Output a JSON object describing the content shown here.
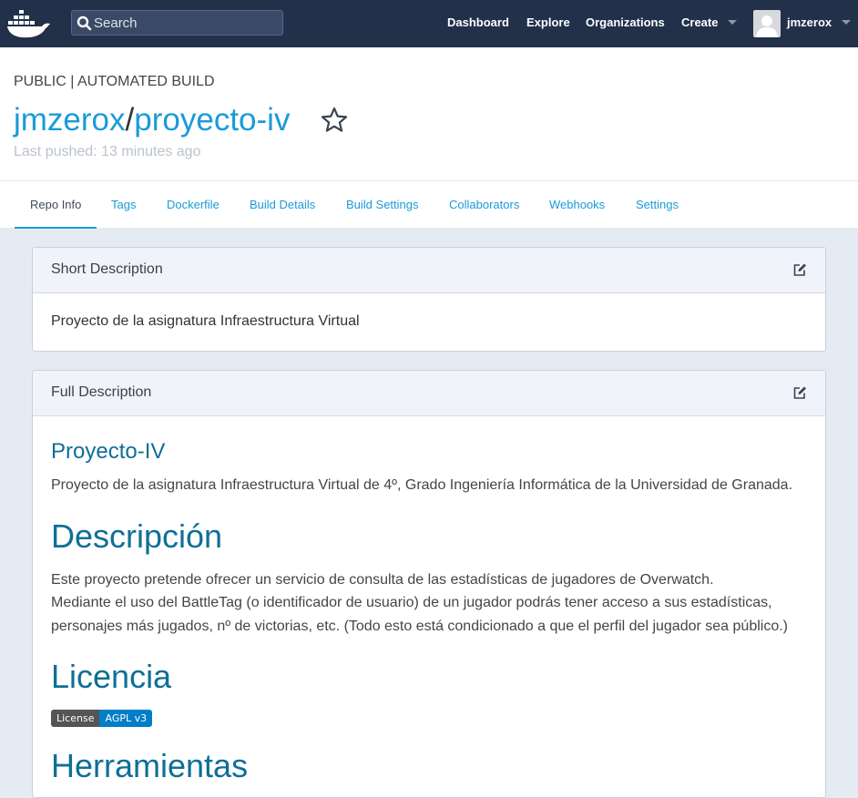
{
  "nav": {
    "search_placeholder": "Search",
    "links": [
      "Dashboard",
      "Explore",
      "Organizations",
      "Create"
    ],
    "username": "jmzerox"
  },
  "header": {
    "repo_type": "PUBLIC | AUTOMATED BUILD",
    "owner": "jmzerox",
    "separator": "/",
    "repo_name": "proyecto-iv",
    "last_pushed": "Last pushed: 13 minutes ago"
  },
  "tabs": [
    "Repo Info",
    "Tags",
    "Dockerfile",
    "Build Details",
    "Build Settings",
    "Collaborators",
    "Webhooks",
    "Settings"
  ],
  "short_description": {
    "title": "Short Description",
    "text": "Proyecto de la asignatura Infraestructura Virtual"
  },
  "full_description": {
    "title": "Full Description",
    "h_proyecto": "Proyecto-IV",
    "p_proyecto": "Proyecto de la asignatura Infraestructura Virtual de 4º, Grado Ingeniería Informática de la Universidad de Granada.",
    "h_descripcion": "Descripción",
    "p_descripcion_1": "Este proyecto pretende ofrecer un servicio de consulta de las estadísticas de jugadores de Overwatch.",
    "p_descripcion_2": "Mediante el uso del BattleTag (o identificador de usuario) de un jugador podrás tener acceso a sus estadísticas, personajes más jugados, nº de victorias, etc. (Todo esto está condicionado a que el perfil del jugador sea público.)",
    "h_licencia": "Licencia",
    "badge_label": "License",
    "badge_value": "AGPL v3",
    "h_herramientas": "Herramientas"
  },
  "colors": {
    "nav_bg": "#22304a",
    "link": "#1a9bd7",
    "heading": "#0f6f96",
    "page_bg": "#e4ebf3"
  }
}
